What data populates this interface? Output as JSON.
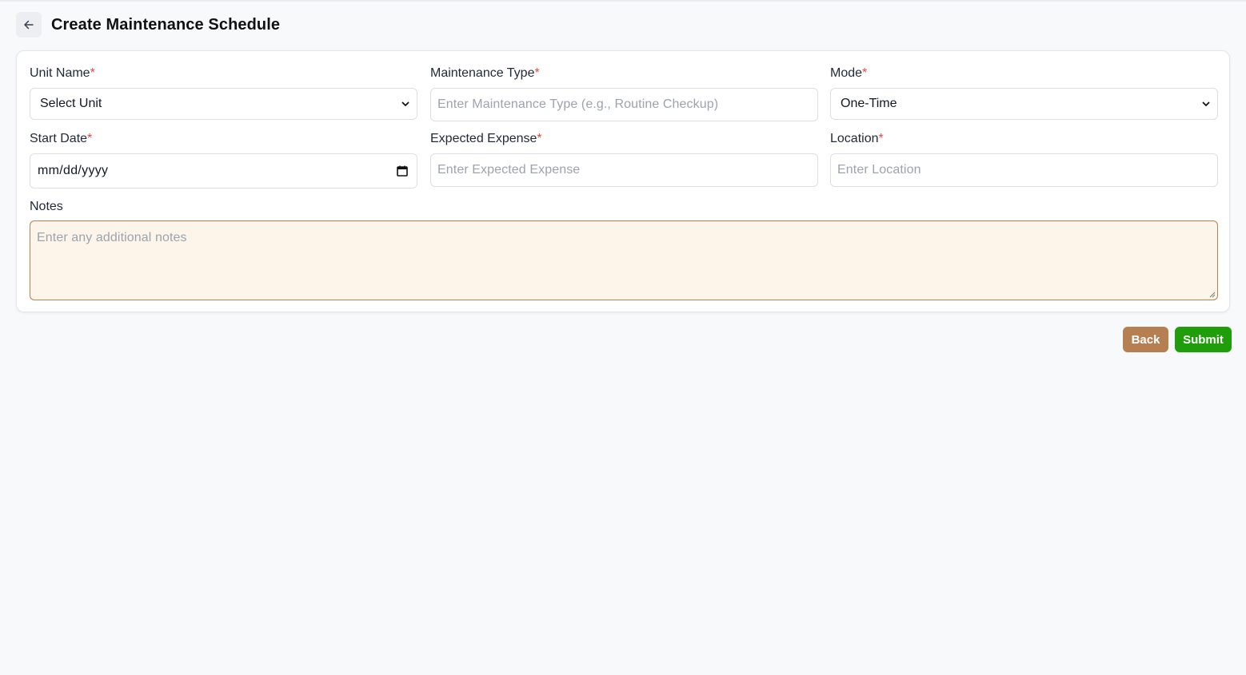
{
  "header": {
    "title": "Create Maintenance Schedule"
  },
  "form": {
    "unit_name": {
      "label": "Unit Name",
      "required": "*",
      "value": "Select Unit"
    },
    "maintenance_type": {
      "label": "Maintenance Type",
      "required": "*",
      "placeholder": "Enter Maintenance Type (e.g., Routine Checkup)"
    },
    "mode": {
      "label": "Mode",
      "required": "*",
      "value": "One-Time"
    },
    "start_date": {
      "label": "Start Date",
      "required": "*",
      "value": "mm/dd/yyyy"
    },
    "expected_expense": {
      "label": "Expected Expense",
      "required": "*",
      "placeholder": "Enter Expected Expense"
    },
    "location": {
      "label": "Location",
      "required": "*",
      "placeholder": "Enter Location"
    },
    "notes": {
      "label": "Notes",
      "placeholder": "Enter any additional notes"
    }
  },
  "actions": {
    "back_label": "Back",
    "submit_label": "Submit"
  },
  "colors": {
    "back_button": "#b67f52",
    "submit_button": "#1f9d0b",
    "required_mark": "#ef4444",
    "notes_bg": "#fdf4ea",
    "notes_border": "#b4824f"
  },
  "icons": {
    "header_back": "arrow-left-icon",
    "select": "chevron-down-icon",
    "date": "calendar-icon"
  }
}
